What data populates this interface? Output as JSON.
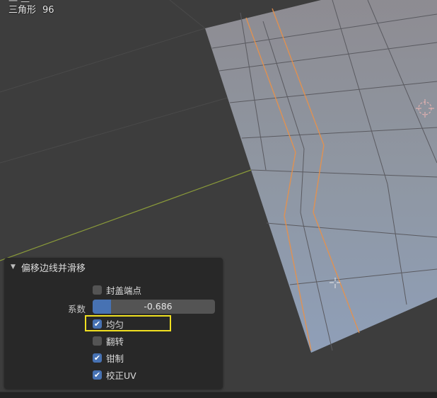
{
  "stats": {
    "top_row_partial": "一    —",
    "triangles_label": "三角形",
    "triangles_value": "96"
  },
  "operator_panel": {
    "title": "偏移边线并滑移",
    "options": {
      "cap_endpoint": {
        "label": "封盖端点",
        "checked": false
      },
      "factor": {
        "label": "系数",
        "value": "-0.686",
        "fraction": 0.15
      },
      "even": {
        "label": "均匀",
        "checked": true
      },
      "flip": {
        "label": "翻转",
        "checked": false
      },
      "clamp": {
        "label": "钳制",
        "checked": true
      },
      "correct_uv": {
        "label": "校正UV",
        "checked": true
      }
    }
  },
  "colors": {
    "viewport_bg": "#3d3d3d",
    "panel_bg": "#282828",
    "accent": "#4772b3",
    "highlight": "#f0e020",
    "mesh_edge_selected": "#e8914a",
    "x_axis": "#8a9a3a"
  },
  "icons": {
    "collapse": "triangle-down-icon",
    "check": "checkmark-icon",
    "origin": "origin-crosshair-icon",
    "cursor3d": "3d-cursor-icon"
  }
}
